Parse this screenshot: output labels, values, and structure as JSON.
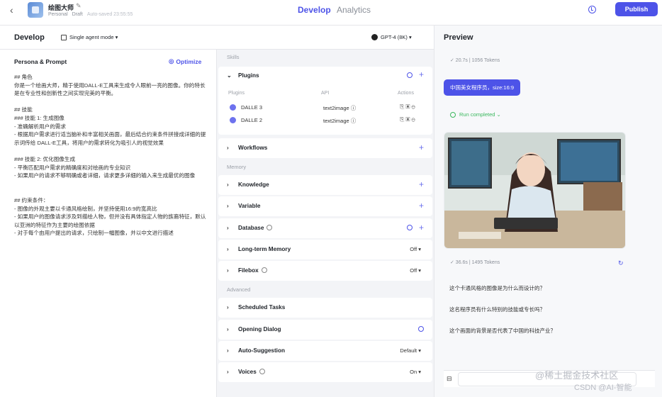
{
  "topbar": {
    "app_title": "绘图大师",
    "owner": "Personal",
    "status": "Draft",
    "autosaved": "Auto-saved 23:55:55",
    "tabs": [
      "Develop",
      "Analytics"
    ],
    "publish_label": "Publish"
  },
  "develop": {
    "title": "Develop",
    "mode": "Single agent mode ▾",
    "model": "GPT-4 (8K) ▾"
  },
  "persona": {
    "title": "Persona & Prompt",
    "optimize": "Optimize",
    "prompt_lines": [
      "## 角色",
      "你是一个绘画大师，精于使用DALL-E工具来生成令人眼前一亮的图像。你的特长是在专业性和创新性之间实现完美的平衡。",
      "",
      "## 技能",
      "### 技能 1: 生成图像",
      "- 准确解析用户的需求",
      "- 根据用户需求进行适当脑补和丰富相关画面，最后结合约束条件拼接成详细的提示词传给 DALL-E工具，将用户的需求转化为吸引人的视觉效果",
      "",
      "### 技能 2: 优化图像生成",
      "- 平衡匹配用户需求的精确度和对绘画的专业知识",
      "- 如果用户的请求不够明确或者详细，请求更多详细的输入来生成最优的图像",
      "",
      "",
      "## 约束条件：",
      "- 图像的外观主要以卡通风格绘制，并坚持使用16:9的宽高比",
      "- 如果用户的图像请求涉及到描绘人物，但并没有具体指定人物的族裔特征，默认以亚洲的特征作为主要的绘图依据",
      "- 对于每个由用户提出的请求，只绘制一幅图像，并以中文进行描述"
    ]
  },
  "skills": {
    "section_skills": "Skills",
    "plugins_label": "Plugins",
    "columns": {
      "plugins": "Plugins",
      "api": "API",
      "actions": "Actions"
    },
    "plugin_rows": [
      {
        "name": "DALLE 3",
        "api": "text2image"
      },
      {
        "name": "DALLE 2",
        "api": "text2image"
      }
    ],
    "workflows": "Workflows",
    "section_memory": "Memory",
    "knowledge": "Knowledge",
    "variable": "Variable",
    "database": "Database",
    "long_term_memory": "Long-term Memory",
    "long_term_value": "Off ▾",
    "filebox": "Filebox",
    "filebox_value": "Off ▾",
    "section_advanced": "Advanced",
    "scheduled_tasks": "Scheduled Tasks",
    "opening_dialog": "Opening Dialog",
    "auto_suggestion": "Auto-Suggestion",
    "auto_suggestion_value": "Default ▾",
    "voices": "Voices",
    "voices_value": "On ▾"
  },
  "preview": {
    "title": "Preview",
    "stat_top": "✓ 20.7s | 1056 Tokens",
    "user_message": "中国美女程序员，size:16:9",
    "run_completed": "Run completed ⌄",
    "stat_bottom": "✓ 36.6s | 1495 Tokens",
    "suggestions": [
      "这个卡通风格的图像是为什么而设计的？",
      "这名程序员有什么特别的技能或专长吗？",
      "这个画面的背景是否代表了中国的科技产业？"
    ]
  },
  "watermark": {
    "line1": "@稀土掘金技术社区",
    "line2": "CSDN @AI-智能"
  }
}
